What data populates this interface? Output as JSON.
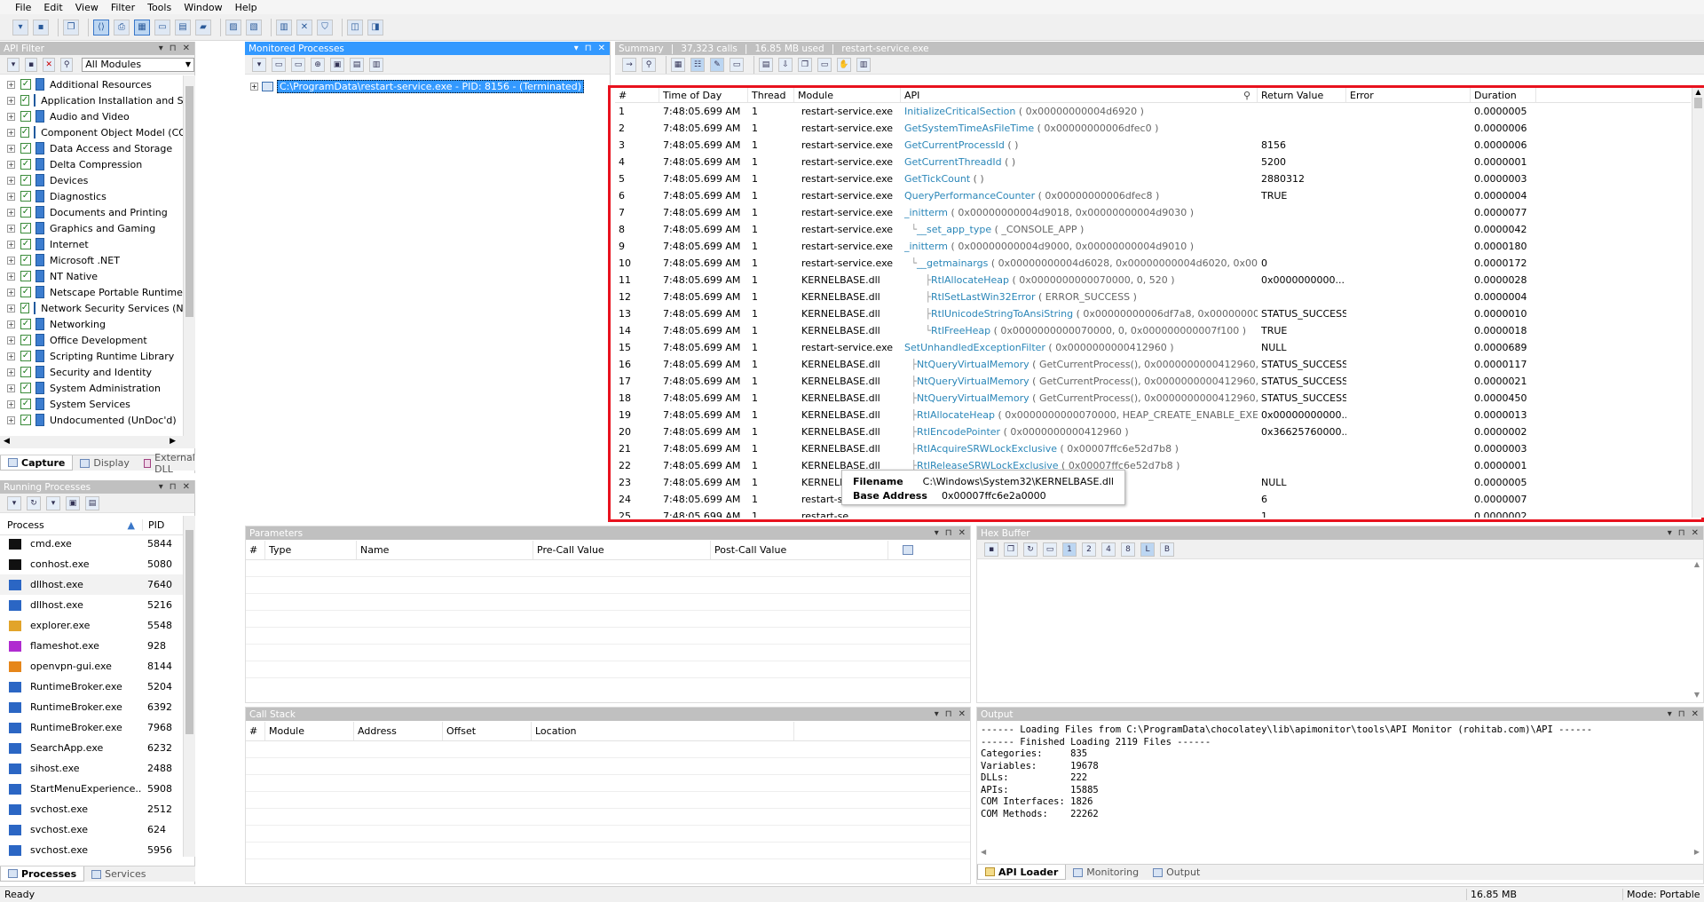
{
  "menu": [
    "File",
    "Edit",
    "View",
    "Filter",
    "Tools",
    "Window",
    "Help"
  ],
  "api_filter": {
    "title": "API Filter",
    "module_select": "All Modules",
    "items": [
      "Additional Resources",
      "Application Installation and Servicing",
      "Audio and Video",
      "Component Object Model (COM)",
      "Data Access and Storage",
      "Delta Compression",
      "Devices",
      "Diagnostics",
      "Documents and Printing",
      "Graphics and Gaming",
      "Internet",
      "Microsoft .NET",
      "NT Native",
      "Netscape Portable Runtime",
      "Network Security Services (NSS)",
      "Networking",
      "Office Development",
      "Scripting Runtime Library",
      "Security and Identity",
      "System Administration",
      "System Services",
      "Undocumented (UnDoc'd)"
    ],
    "tabs": [
      "Capture",
      "Display",
      "External DLL"
    ]
  },
  "running": {
    "title": "Running Processes",
    "headers": [
      "Process",
      "PID"
    ],
    "rows": [
      [
        "cmd.exe",
        "5844"
      ],
      [
        "conhost.exe",
        "5080"
      ],
      [
        "dllhost.exe",
        "7640"
      ],
      [
        "dllhost.exe",
        "5216"
      ],
      [
        "explorer.exe",
        "5548"
      ],
      [
        "flameshot.exe",
        "928"
      ],
      [
        "openvpn-gui.exe",
        "8144"
      ],
      [
        "RuntimeBroker.exe",
        "5204"
      ],
      [
        "RuntimeBroker.exe",
        "6392"
      ],
      [
        "RuntimeBroker.exe",
        "7968"
      ],
      [
        "SearchApp.exe",
        "6232"
      ],
      [
        "sihost.exe",
        "2488"
      ],
      [
        "StartMenuExperience...",
        "5908"
      ],
      [
        "svchost.exe",
        "2512"
      ],
      [
        "svchost.exe",
        "624"
      ],
      [
        "svchost.exe",
        "5956"
      ]
    ],
    "tabs": [
      "Processes",
      "Services"
    ]
  },
  "monitored": {
    "title": "Monitored Processes",
    "item": "C:\\ProgramData\\restart-service.exe - PID: 8156 - (Terminated)"
  },
  "summary": {
    "label": "Summary",
    "calls": "37,323 calls",
    "mem": "16.85 MB used",
    "proc": "restart-service.exe"
  },
  "calls": {
    "headers": [
      "#",
      "Time of Day",
      "Thread",
      "Module",
      "API",
      "Return Value",
      "Error",
      "Duration"
    ],
    "rows": [
      [
        "1",
        "7:48:05.699 AM",
        "1",
        "restart-service.exe",
        "",
        "InitializeCriticalSection",
        " ( 0x00000000004d6920 )",
        "",
        "0.0000005"
      ],
      [
        "2",
        "7:48:05.699 AM",
        "1",
        "restart-service.exe",
        "",
        "GetSystemTimeAsFileTime",
        " ( 0x00000000006dfec0 )",
        "",
        "0.0000006"
      ],
      [
        "3",
        "7:48:05.699 AM",
        "1",
        "restart-service.exe",
        "",
        "GetCurrentProcessId",
        " ( )",
        "8156",
        "0.0000006"
      ],
      [
        "4",
        "7:48:05.699 AM",
        "1",
        "restart-service.exe",
        "",
        "GetCurrentThreadId",
        " ( )",
        "5200",
        "0.0000001"
      ],
      [
        "5",
        "7:48:05.699 AM",
        "1",
        "restart-service.exe",
        "",
        "GetTickCount",
        " ( )",
        "2880312",
        "0.0000003"
      ],
      [
        "6",
        "7:48:05.699 AM",
        "1",
        "restart-service.exe",
        "",
        "QueryPerformanceCounter",
        " ( 0x00000000006dfec8 )",
        "TRUE",
        "0.0000004"
      ],
      [
        "7",
        "7:48:05.699 AM",
        "1",
        "restart-service.exe",
        "",
        "_initterm",
        " ( 0x00000000004d9018, 0x00000000004d9030 )",
        "",
        "0.0000077"
      ],
      [
        "8",
        "7:48:05.699 AM",
        "1",
        "restart-service.exe",
        "└",
        "__set_app_type",
        " ( _CONSOLE_APP )",
        "",
        "0.0000042"
      ],
      [
        "9",
        "7:48:05.699 AM",
        "1",
        "restart-service.exe",
        "",
        "_initterm",
        " ( 0x00000000004d9000, 0x00000000004d9010 )",
        "",
        "0.0000180"
      ],
      [
        "10",
        "7:48:05.699 AM",
        "1",
        "restart-service.exe",
        "└",
        "__getmainargs",
        " ( 0x00000000004d6028, 0x00000000004d6020, 0x000000...",
        "0",
        "0.0000172"
      ],
      [
        "11",
        "7:48:05.699 AM",
        "1",
        "KERNELBASE.dll",
        "  ├",
        "RtlAllocateHeap",
        " ( 0x0000000000070000, 0, 520 )",
        "0x0000000000...",
        "0.0000028"
      ],
      [
        "12",
        "7:48:05.699 AM",
        "1",
        "KERNELBASE.dll",
        "  ├",
        "RtlSetLastWin32Error",
        " ( ERROR_SUCCESS )",
        "",
        "0.0000004"
      ],
      [
        "13",
        "7:48:05.699 AM",
        "1",
        "KERNELBASE.dll",
        "  ├",
        "RtlUnicodeStringToAnsiString",
        " ( 0x00000000006df7a8, 0x000000000...",
        "STATUS_SUCCESS",
        "0.0000010"
      ],
      [
        "14",
        "7:48:05.699 AM",
        "1",
        "KERNELBASE.dll",
        "  └",
        "RtlFreeHeap",
        " ( 0x0000000000070000, 0, 0x000000000007f100 )",
        "TRUE",
        "0.0000018"
      ],
      [
        "15",
        "7:48:05.699 AM",
        "1",
        "restart-service.exe",
        "",
        "SetUnhandledExceptionFilter",
        " ( 0x0000000000412960 )",
        "NULL",
        "0.0000689"
      ],
      [
        "16",
        "7:48:05.699 AM",
        "1",
        "KERNELBASE.dll",
        "├",
        "NtQueryVirtualMemory",
        " ( GetCurrentProcess(), 0x0000000000412960, M...",
        "STATUS_SUCCESS",
        "0.0000117"
      ],
      [
        "17",
        "7:48:05.699 AM",
        "1",
        "KERNELBASE.dll",
        "├",
        "NtQueryVirtualMemory",
        " ( GetCurrentProcess(), 0x0000000000412960, M...",
        "STATUS_SUCCESS",
        "0.0000021"
      ],
      [
        "18",
        "7:48:05.699 AM",
        "1",
        "KERNELBASE.dll",
        "├",
        "NtQueryVirtualMemory",
        " ( GetCurrentProcess(), 0x0000000000412960, M...",
        "STATUS_SUCCESS",
        "0.0000450"
      ],
      [
        "19",
        "7:48:05.699 AM",
        "1",
        "KERNELBASE.dll",
        "├",
        "RtlAllocateHeap",
        " ( 0x0000000000070000, HEAP_CREATE_ENABLE_EXECUT...",
        "0x00000000000...",
        "0.0000013"
      ],
      [
        "20",
        "7:48:05.699 AM",
        "1",
        "KERNELBASE.dll",
        "├",
        "RtlEncodePointer",
        " ( 0x0000000000412960 )",
        "0x36625760000...",
        "0.0000002"
      ],
      [
        "21",
        "7:48:05.699 AM",
        "1",
        "KERNELBASE.dll",
        "├",
        "RtlAcquireSRWLockExclusive",
        " ( 0x00007ffc6e52d7b8 )",
        "",
        "0.0000003"
      ],
      [
        "22",
        "7:48:05.699 AM",
        "1",
        "KERNELBASE.dll",
        "├",
        "RtlReleaseSRWLockExclusive",
        " ( 0x00007ffc6e52d7b8 )",
        "",
        "0.0000001"
      ],
      [
        "23",
        "7:48:05.699 AM",
        "1",
        "KERNELBASE.dll",
        "",
        "",
        "",
        "NULL",
        "0.0000005"
      ],
      [
        "24",
        "7:48:05.699 AM",
        "1",
        "restart-se",
        "",
        "",
        "",
        "6",
        "0.0000007"
      ],
      [
        "25",
        "7:48:05.699 AM",
        "1",
        "restart-se",
        "",
        "",
        "",
        "1",
        "0.0000002"
      ]
    ]
  },
  "tooltip": {
    "k1": "Filename",
    "v1": "C:\\Windows\\System32\\KERNELBASE.dll",
    "k2": "Base Address",
    "v2": "0x00007ffc6e2a0000"
  },
  "params": {
    "title": "Parameters",
    "headers": [
      "#",
      "Type",
      "Name",
      "Pre-Call Value",
      "Post-Call Value"
    ]
  },
  "hex": {
    "title": "Hex Buffer"
  },
  "callstack": {
    "title": "Call Stack",
    "headers": [
      "#",
      "Module",
      "Address",
      "Offset",
      "Location"
    ]
  },
  "output": {
    "title": "Output",
    "lines": [
      "------ Loading Files from C:\\ProgramData\\chocolatey\\lib\\apimonitor\\tools\\API Monitor (rohitab.com)\\API ------",
      "------ Finished Loading 2119 Files ------",
      "Categories:     835",
      "Variables:      19678",
      "DLLs:           222",
      "APIs:           15885",
      "COM Interfaces: 1826",
      "COM Methods:    22262"
    ],
    "tabs": [
      "API Loader",
      "Monitoring",
      "Output"
    ]
  },
  "status": {
    "left": "Ready",
    "mem": "16.85 MB",
    "mode": "Mode: Portable"
  },
  "colors": {
    "accent": "#3399ff",
    "highlight": "#e8121e",
    "api_link": "#2a86b8"
  }
}
